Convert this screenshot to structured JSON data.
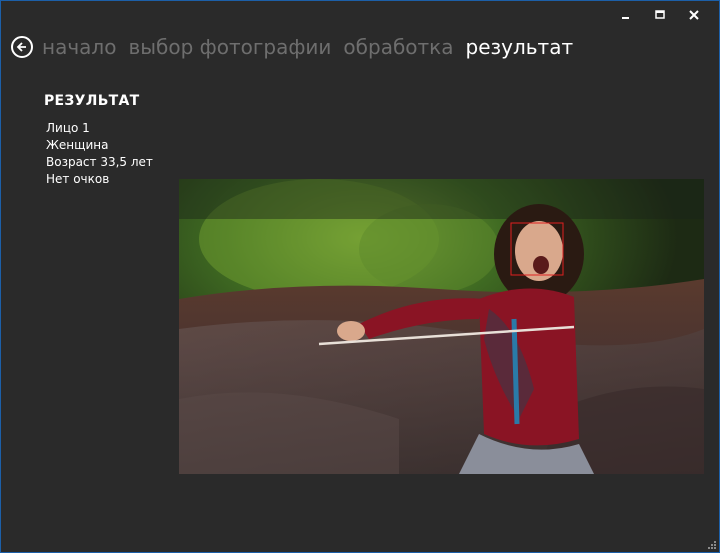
{
  "nav": {
    "back_icon": "back-arrow-icon",
    "crumbs": [
      {
        "label": "начало",
        "active": false
      },
      {
        "label": "выбор фотографии",
        "active": false
      },
      {
        "label": "обработка",
        "active": false
      },
      {
        "label": "результат",
        "active": true
      }
    ]
  },
  "window_controls": {
    "minimize_icon": "minimize-icon",
    "maximize_icon": "maximize-icon",
    "close_icon": "close-icon"
  },
  "result": {
    "title": "РЕЗУЛЬТАТ",
    "lines": [
      "Лицо 1",
      "Женщина",
      "Возраст 33,5 лет",
      "Нет очков"
    ]
  },
  "photo": {
    "face_box_color": "#e02020"
  },
  "colors": {
    "background": "#2a2a2a",
    "inactive_crumb": "#6e6e6e",
    "window_border": "#1c5fa8"
  }
}
